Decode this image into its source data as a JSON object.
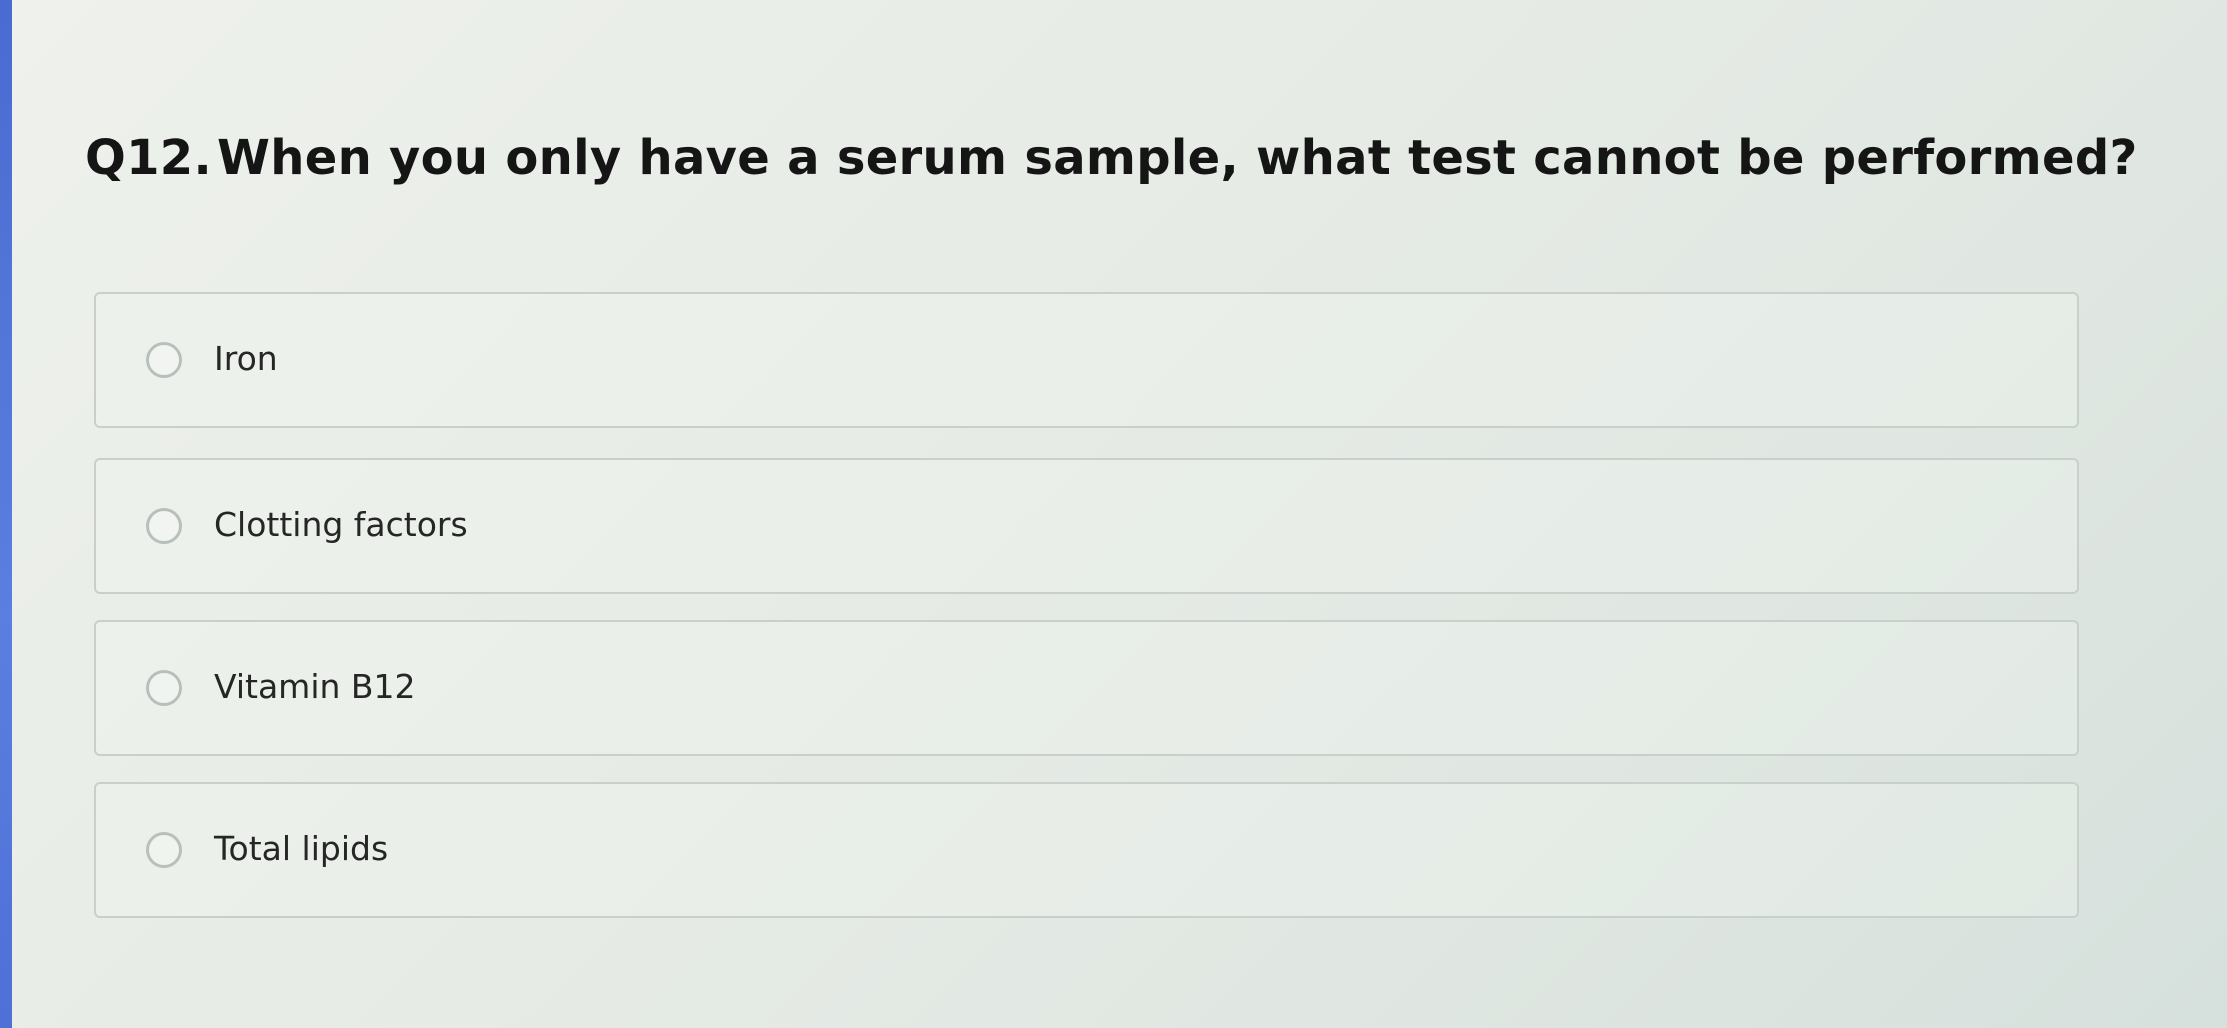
{
  "question": {
    "number": "Q12.",
    "text": "When you only have a serum sample, what test cannot be performed?"
  },
  "options": [
    {
      "label": "Iron",
      "selected": false
    },
    {
      "label": "Clotting factors",
      "selected": false
    },
    {
      "label": "Vitamin B12",
      "selected": false
    },
    {
      "label": "Total lipids",
      "selected": false
    }
  ],
  "colors": {
    "background": "#e6ebe6",
    "text": "#151515",
    "option_border": "#c9cfcb",
    "left_edge": "#4a6bd0"
  }
}
